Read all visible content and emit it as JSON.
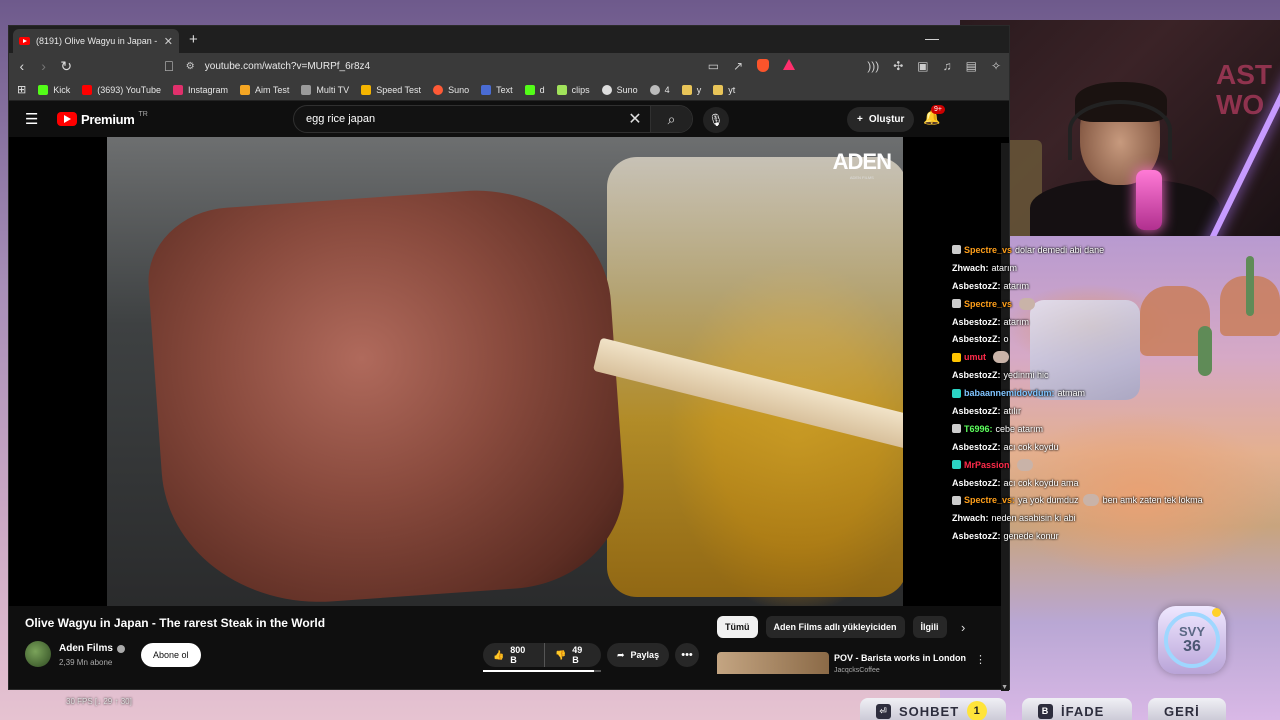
{
  "browser": {
    "tab_title": "(8191) Olive Wagyu in Japan - Th",
    "url": "youtube.com/watch?v=MURPf_6r8z4",
    "bookmarks": [
      {
        "label": "Kick",
        "color": "#53fc18"
      },
      {
        "label": "(3693) YouTube",
        "color": "#ff0000"
      },
      {
        "label": "Instagram",
        "color": "#e1306c"
      },
      {
        "label": "Aim Test",
        "color": "#f5a623"
      },
      {
        "label": "Multi TV",
        "color": "#9a9a9a"
      },
      {
        "label": "Speed Test",
        "color": "#f4b400"
      },
      {
        "label": "Suno",
        "color": "#ff5a36"
      },
      {
        "label": "Text",
        "color": "#4a6cd4"
      },
      {
        "label": "d",
        "color": "#53fc18"
      },
      {
        "label": "clips",
        "color": "#a0e25a"
      },
      {
        "label": "Suno",
        "color": "#dddddd"
      },
      {
        "label": "4",
        "color": "#bbbbbb"
      },
      {
        "label": "y",
        "color": "#e8c458"
      },
      {
        "label": "yt",
        "color": "#e8c458"
      }
    ]
  },
  "youtube": {
    "logo_text": "Premium",
    "logo_region": "TR",
    "search_query": "egg rice japan",
    "create_label": "Oluştur",
    "notifications_badge": "9+",
    "video_watermark": "ADEN",
    "video_watermark_sub": "ADEN FILMS",
    "video_title": "Olive Wagyu in Japan - The rarest Steak in the World",
    "channel_name": "Aden Films",
    "channel_subs": "2,39 Mn abone",
    "subscribe_label": "Abone ol",
    "likes": "800 B",
    "dislikes": "49 B",
    "like_ratio": 0.94,
    "share_label": "Paylaş",
    "chips": [
      "Tümü",
      "Aden Films adlı yükleyiciden",
      "İlgili"
    ],
    "rec_title": "POV - Barista works in London",
    "rec_channel": "JacqcksCoffee"
  },
  "chat": [
    {
      "user": "Spectre_vs",
      "user_color": "#ff9f1a",
      "badge": "#cccccc",
      "msg": "dolar demedi abi dane",
      "emote": false
    },
    {
      "user": "Zhwach:",
      "user_color": "#ffffff",
      "badge": "",
      "msg": "atarım",
      "emote": false
    },
    {
      "user": "AsbestozZ:",
      "user_color": "#ffffff",
      "badge": "",
      "msg": "atarım",
      "emote": false
    },
    {
      "user": "Spectre_vs",
      "user_color": "#ff9f1a",
      "badge": "#cccccc",
      "msg": "",
      "emote": true
    },
    {
      "user": "AsbestozZ:",
      "user_color": "#ffffff",
      "badge": "",
      "msg": "atarım",
      "emote": false
    },
    {
      "user": "AsbestozZ:",
      "user_color": "#ffffff",
      "badge": "",
      "msg": "o",
      "emote": false
    },
    {
      "user": "umut",
      "user_color": "#ff2b4a",
      "badge": "#ffc400",
      "msg": "",
      "emote": true
    },
    {
      "user": "AsbestozZ:",
      "user_color": "#ffffff",
      "badge": "",
      "msg": "yedinmi hic",
      "emote": false
    },
    {
      "user": "babaannemidovdum:",
      "user_color": "#7fc4ff",
      "badge": "#2bd4c4",
      "msg": "atmam",
      "emote": false
    },
    {
      "user": "AsbestozZ:",
      "user_color": "#ffffff",
      "badge": "",
      "msg": "atılır",
      "emote": false
    },
    {
      "user": "T6996:",
      "user_color": "#5cff5c",
      "badge": "#cccccc",
      "msg": "cebe atarım",
      "emote": false
    },
    {
      "user": "AsbestozZ:",
      "user_color": "#ffffff",
      "badge": "",
      "msg": "acı cok koydu",
      "emote": false
    },
    {
      "user": "MrPassion",
      "user_color": "#ff2b4a",
      "badge": "#2bd4c4",
      "msg": "",
      "emote": true
    },
    {
      "user": "AsbestozZ:",
      "user_color": "#ffffff",
      "badge": "",
      "msg": "acı cok koydu ama",
      "emote": false
    },
    {
      "user": "Spectre_vs:",
      "user_color": "#ff9f1a",
      "badge": "#cccccc",
      "msg": "ya yok dumduz",
      "emote": true,
      "msg2": "ben amk zaten tek lokma"
    },
    {
      "user": "Zhwach:",
      "user_color": "#ffffff",
      "badge": "",
      "msg": "neden asabisin ki abi",
      "emote": false
    },
    {
      "user": "AsbestozZ:",
      "user_color": "#ffffff",
      "badge": "",
      "msg": "genede konur",
      "emote": false
    }
  ],
  "hud": {
    "level_label": "SVY",
    "level_value": "36",
    "fps_text": "30 FPS [↓ 29 ↑ 30]",
    "chat_label": "SOHBET",
    "chat_key": "⏎",
    "chat_count": "1",
    "emote_label": "İFADE",
    "emote_key": "B",
    "back_label": "GERİ"
  }
}
